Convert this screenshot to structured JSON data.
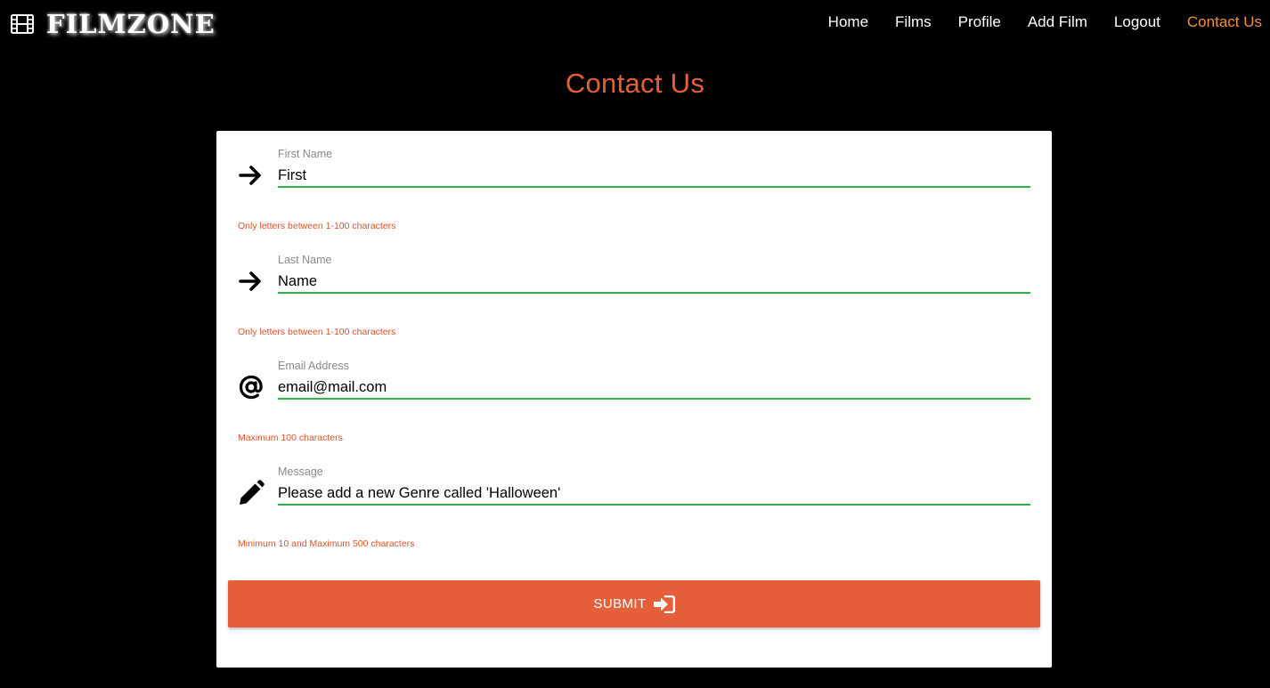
{
  "brand": {
    "name": "FILMZONE",
    "icon": "film-icon"
  },
  "nav": {
    "items": [
      {
        "label": "Home"
      },
      {
        "label": "Films"
      },
      {
        "label": "Profile"
      },
      {
        "label": "Add Film"
      },
      {
        "label": "Logout"
      },
      {
        "label": "Contact Us",
        "active": true
      }
    ]
  },
  "page": {
    "title": "Contact Us"
  },
  "form": {
    "fields": [
      {
        "label": "First Name",
        "value": "First",
        "hint": "Only letters between 1-100 characters",
        "icon": "arrow-right-icon"
      },
      {
        "label": "Last Name",
        "value": "Name",
        "hint": "Only letters between 1-100 characters",
        "icon": "arrow-right-icon"
      },
      {
        "label": "Email Address",
        "value": "email@mail.com",
        "hint": "Maximum 100 characters",
        "icon": "at-sign-icon"
      },
      {
        "label": "Message",
        "value": "Please add a new Genre called 'Halloween'",
        "hint": "Minimum 10 and Maximum 500 characters",
        "icon": "pencil-icon"
      }
    ],
    "submit_label": "SUBMIT",
    "submit_icon": "sign-in-icon"
  },
  "colors": {
    "accent": "#e5603a",
    "active_nav": "#f0923a",
    "valid_underline": "#2bb24c",
    "hint_text": "#d9542c",
    "background": "#000000",
    "card": "#ffffff"
  }
}
